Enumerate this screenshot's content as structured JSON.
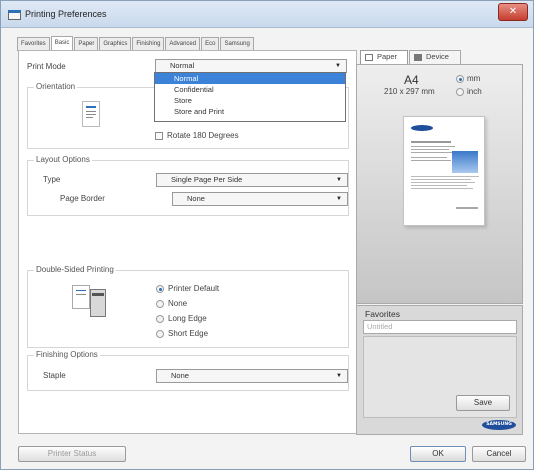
{
  "window": {
    "title": "Printing Preferences",
    "close_glyph": "✕"
  },
  "tabs": [
    "Favorites",
    "Basic",
    "Paper",
    "Graphics",
    "Finishing",
    "Advanced",
    "Eco",
    "Samsung"
  ],
  "active_tab": "Basic",
  "print_mode": {
    "label": "Print Mode",
    "value": "Normal",
    "options": [
      "Normal",
      "Confidential",
      "Store",
      "Store and Print"
    ],
    "selected_index": 0
  },
  "orientation": {
    "title": "Orientation",
    "rotate_label": "Rotate 180 Degrees",
    "rotate_checked": false
  },
  "layout": {
    "title": "Layout Options",
    "type_label": "Type",
    "type_value": "Single Page Per Side",
    "border_label": "Page Border",
    "border_value": "None"
  },
  "duplex": {
    "title": "Double-Sided Printing",
    "options": [
      "Printer Default",
      "None",
      "Long Edge",
      "Short Edge"
    ],
    "selected": "Printer Default"
  },
  "finishing": {
    "title": "Finishing Options",
    "staple_label": "Staple",
    "staple_value": "None"
  },
  "preview": {
    "tab_paper": "Paper",
    "tab_device": "Device",
    "paper_size": "A4",
    "paper_dims": "210 x 297 mm",
    "unit_mm": "mm",
    "unit_inch": "inch",
    "unit_selected": "mm"
  },
  "favorites": {
    "title": "Favorites",
    "placeholder": "Untitled",
    "save_label": "Save"
  },
  "footer": {
    "printer_status_label": "Printer Status",
    "ok_label": "OK",
    "cancel_label": "Cancel"
  },
  "brand": {
    "logo_text": "SAMSUNG",
    "logo_color": "#1f4e9c"
  },
  "colors": {
    "selection": "#3b82d8",
    "title_close": "#c53f2f"
  }
}
